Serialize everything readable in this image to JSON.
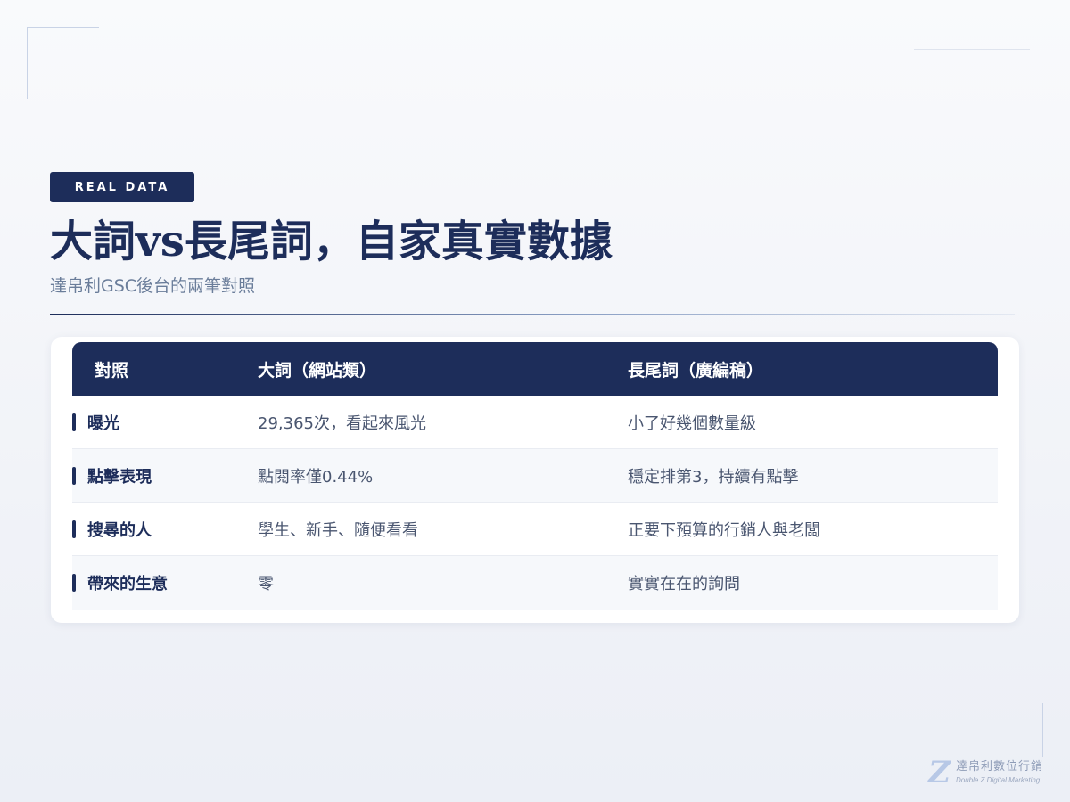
{
  "badge": "REAL DATA",
  "title": "大詞vs長尾詞，自家真實數據",
  "subtitle": "達帛利GSC後台的兩筆對照",
  "table": {
    "headers": [
      "對照",
      "大詞（網站類）",
      "長尾詞（廣編稿）"
    ],
    "rows": [
      {
        "label": "曝光",
        "big": "29,365次，看起來風光",
        "long": "小了好幾個數量級"
      },
      {
        "label": "點擊表現",
        "big": "點閱率僅0.44%",
        "long": "穩定排第3，持續有點擊"
      },
      {
        "label": "搜尋的人",
        "big": "學生、新手、隨便看看",
        "long": "正要下預算的行銷人與老闆"
      },
      {
        "label": "帶來的生意",
        "big": "零",
        "long": "實實在在的詢問"
      }
    ]
  },
  "brand": {
    "mark": "Z",
    "name": "達帛利數位行銷",
    "tagline": "Double Z Digital Marketing"
  },
  "colors": {
    "navy": "#1d2d5a",
    "subtitle": "#6a7d9a",
    "body_text": "#4a5670",
    "background": "#f4f6fa"
  }
}
